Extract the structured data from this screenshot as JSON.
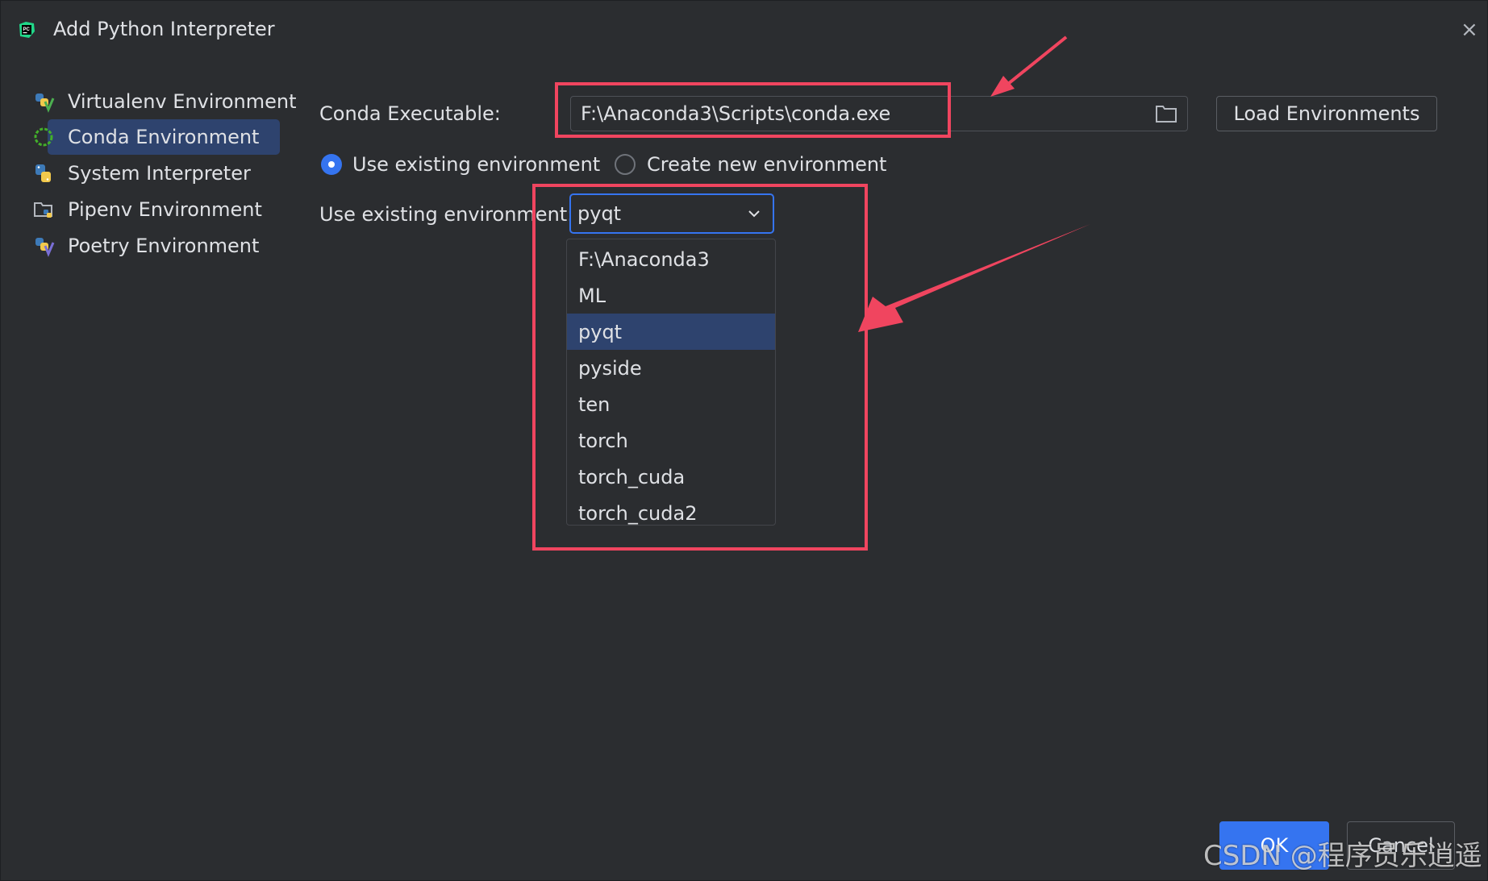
{
  "window": {
    "title": "Add Python Interpreter",
    "close_glyph": "×"
  },
  "sidebar": {
    "items": [
      {
        "label": "Virtualenv Environment",
        "icon": "virtualenv-icon"
      },
      {
        "label": "Conda Environment",
        "icon": "conda-icon"
      },
      {
        "label": "System Interpreter",
        "icon": "python-icon"
      },
      {
        "label": "Pipenv Environment",
        "icon": "folder-python-icon"
      },
      {
        "label": "Poetry Environment",
        "icon": "poetry-icon"
      }
    ],
    "selected": "Conda Environment"
  },
  "form": {
    "conda_label": "Conda Executable:",
    "conda_path": "F:\\Anaconda3\\Scripts\\conda.exe",
    "load_button": "Load Environments",
    "radio_existing": "Use existing environment",
    "radio_new": "Create new environment",
    "env_label": "Use existing environment:",
    "env_selected": "pyqt",
    "env_options": [
      "F:\\Anaconda3",
      "ML",
      "pyqt",
      "pyside",
      "ten",
      "torch",
      "torch_cuda",
      "torch_cuda2"
    ]
  },
  "footer": {
    "ok": "OK",
    "cancel": "Cancel"
  },
  "watermark": "CSDN @程序员乐逍遥",
  "colors": {
    "background": "#2b2d30",
    "accent": "#3574f0",
    "selection": "#2e436e",
    "annotation": "#f0455f"
  }
}
